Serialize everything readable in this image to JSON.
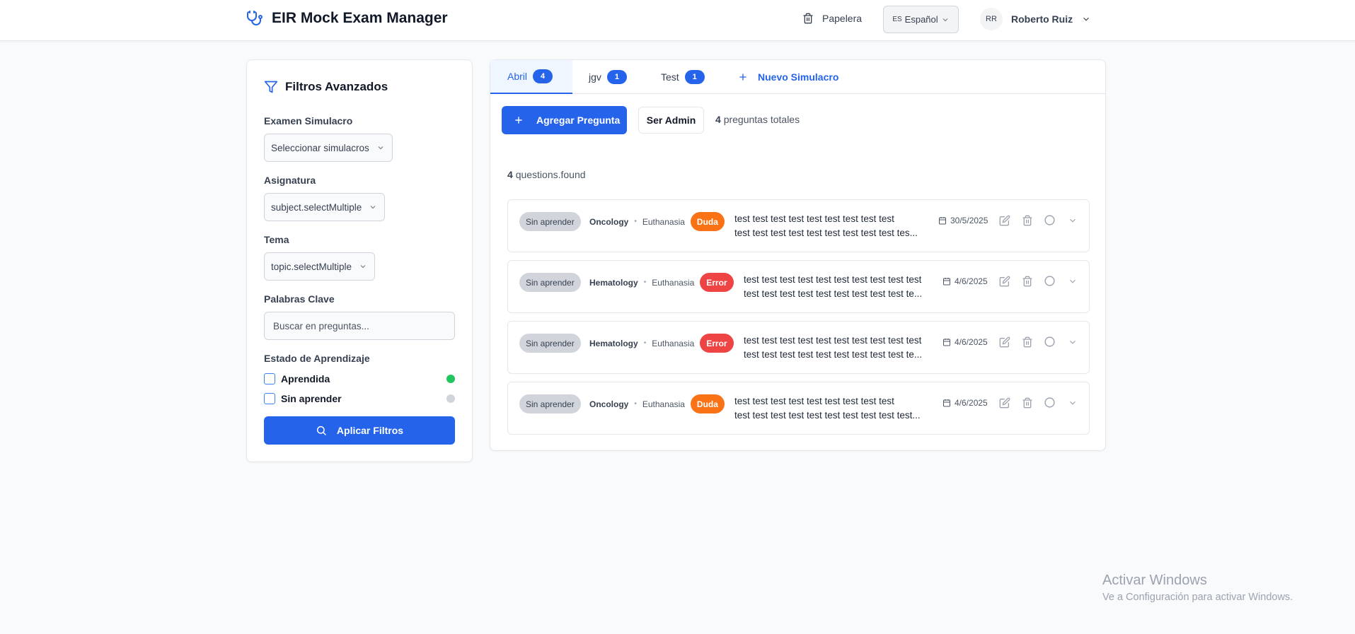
{
  "header": {
    "title": "EIR Mock Exam Manager",
    "trash_label": "Papelera",
    "language": {
      "code": "ES",
      "label": "Español"
    },
    "user": {
      "initials": "RR",
      "name": "Roberto Ruiz"
    }
  },
  "filters": {
    "title": "Filtros Avanzados",
    "exam": {
      "label": "Examen Simulacro",
      "value": "Seleccionar simulacros"
    },
    "subject": {
      "label": "Asignatura",
      "value": "subject.selectMultiple"
    },
    "topic": {
      "label": "Tema",
      "value": "topic.selectMultiple"
    },
    "keywords": {
      "label": "Palabras Clave",
      "placeholder": "Buscar en preguntas..."
    },
    "learning": {
      "label": "Estado de Aprendizaje",
      "options": [
        {
          "label": "Aprendida",
          "checked": false,
          "color": "#22c55e"
        },
        {
          "label": "Sin aprender",
          "checked": false,
          "color": "#d1d5db"
        }
      ]
    },
    "apply_label": "Aplicar Filtros"
  },
  "tabs": [
    {
      "label": "Abril",
      "count": "4",
      "active": true
    },
    {
      "label": "jgv",
      "count": "1",
      "active": false
    },
    {
      "label": "Test",
      "count": "1",
      "active": false
    }
  ],
  "new_tab_label": "Nuevo Simulacro",
  "toolbar": {
    "add_label": "Agregar Pregunta",
    "admin_label": "Ser Admin",
    "total_count": "4",
    "total_suffix": "preguntas totales"
  },
  "found": {
    "count": "4",
    "suffix": "questions.found"
  },
  "questions": [
    {
      "status": "Sin aprender",
      "subject": "Oncology",
      "topic": "Euthanasia",
      "tag": "Duda",
      "tag_color": "#f97316",
      "text_line1": "test test test test test test test test test",
      "text_line2": "test test test test test test test test test tes...",
      "date": "30/5/2025"
    },
    {
      "status": "Sin aprender",
      "subject": "Hematology",
      "topic": "Euthanasia",
      "tag": "Error",
      "tag_color": "#ef4444",
      "text_line1": "test test test test test test test test test test",
      "text_line2": "test test test test test test test test test te...",
      "date": "4/6/2025"
    },
    {
      "status": "Sin aprender",
      "subject": "Hematology",
      "topic": "Euthanasia",
      "tag": "Error",
      "tag_color": "#ef4444",
      "text_line1": "test test test test test test test test test test",
      "text_line2": "test test test test test test test test test te...",
      "date": "4/6/2025"
    },
    {
      "status": "Sin aprender",
      "subject": "Oncology",
      "topic": "Euthanasia",
      "tag": "Duda",
      "tag_color": "#f97316",
      "text_line1": "test test test test test test test test test",
      "text_line2": "test test test test test test test test test test...",
      "date": "4/6/2025"
    }
  ],
  "watermark": {
    "line1": "Activar Windows",
    "line2": "Ve a Configuración para activar Windows."
  },
  "colors": {
    "primary": "#2563eb",
    "learned": "#22c55e",
    "unlearned": "#d1d5db",
    "doubt": "#f97316",
    "error": "#ef4444"
  }
}
